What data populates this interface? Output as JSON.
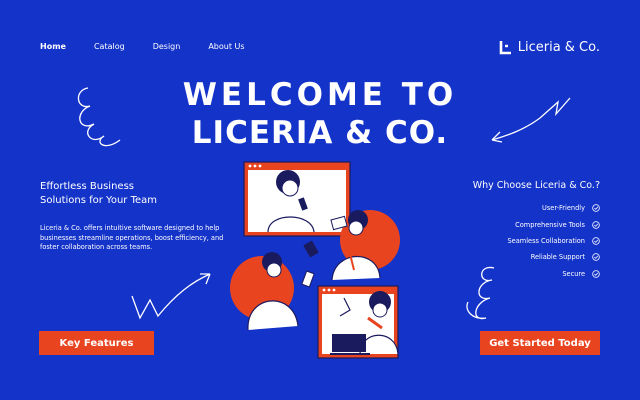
{
  "nav": {
    "items": [
      {
        "label": "Home",
        "active": true
      },
      {
        "label": "Catalog",
        "active": false
      },
      {
        "label": "Design",
        "active": false
      },
      {
        "label": "About Us",
        "active": false
      }
    ]
  },
  "brand": {
    "name": "Liceria & Co.",
    "icon": "brand-logo-icon"
  },
  "hero": {
    "line1": "WELCOME TO",
    "line2": "LICERIA & CO."
  },
  "left": {
    "heading_line1": "Effortless Business",
    "heading_line2": "Solutions for Your Team",
    "description": "Liceria & Co. offers intuitive software designed to help businesses streamline operations, boost efficiency, and foster collaboration across teams.",
    "button_label": "Key Features"
  },
  "right": {
    "heading": "Why Choose Liceria & Co.?",
    "features": [
      "User-Friendly",
      "Comprehensive Tools",
      "Seamless Collaboration",
      "Reliable Support",
      "Secure"
    ],
    "button_label": "Get Started Today"
  },
  "colors": {
    "background": "#1433c9",
    "accent": "#e8441f",
    "text": "#ffffff"
  }
}
